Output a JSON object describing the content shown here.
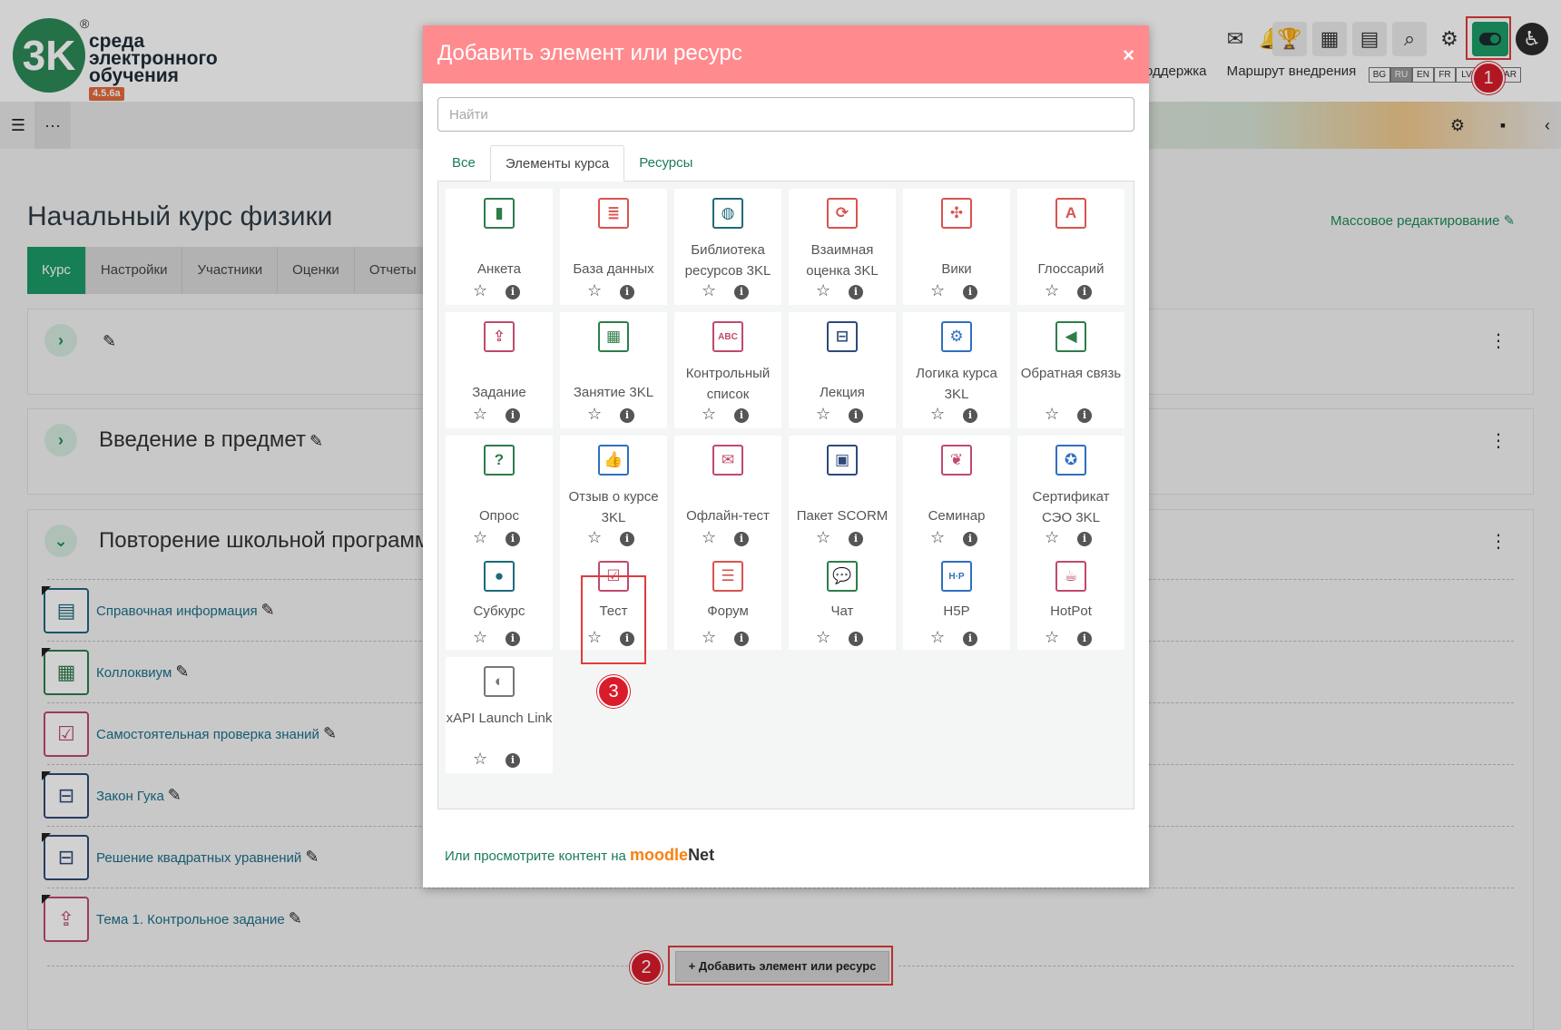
{
  "header": {
    "logo_line1": "среда",
    "logo_line2": "электронного",
    "logo_line3": "обучения",
    "logo_mark": "3K",
    "version": "4.5.6a",
    "links": [
      "оддержка",
      "Маршрут внедрения"
    ],
    "languages": [
      "BG",
      "RU",
      "EN",
      "FR",
      "LV",
      "HE",
      "AR"
    ],
    "active_language": "RU"
  },
  "course": {
    "title": "Начальный курс физики",
    "mass_edit": "Массовое редактирование",
    "tabs": [
      "Курс",
      "Настройки",
      "Участники",
      "Оценки",
      "Отчеты"
    ],
    "sections": [
      {
        "title": ""
      },
      {
        "title": "Введение в предмет"
      },
      {
        "title": "Повторение школьной программ"
      }
    ],
    "activities": [
      {
        "name": "Справочная информация",
        "icon": "file-icon"
      },
      {
        "name": "Коллоквиум",
        "icon": "lesson-icon"
      },
      {
        "name": "Самостоятельная проверка знаний",
        "icon": "quiz-icon"
      },
      {
        "name": "Закон Гука",
        "icon": "lecture-icon"
      },
      {
        "name": "Решение квадратных уравнений",
        "icon": "lecture-icon"
      },
      {
        "name": "Тема 1. Контрольное задание",
        "icon": "assign-icon"
      }
    ],
    "add_button": "+ Добавить элемент или ресурс"
  },
  "modal": {
    "title": "Добавить элемент или ресурс",
    "close": "×",
    "search_placeholder": "Найти",
    "tabs": [
      "Все",
      "Элементы курса",
      "Ресурсы"
    ],
    "active_tab": "Элементы курса",
    "items": [
      {
        "label": "Анкета",
        "icon": "survey-icon",
        "color": "#2e7d4a",
        "glyph": "▮"
      },
      {
        "label": "База данных",
        "icon": "database-icon",
        "color": "#d9534f",
        "glyph": "≣"
      },
      {
        "label": "Библиотека ресурсов 3KL",
        "icon": "library-icon",
        "color": "#1e6a7a",
        "glyph": "◍"
      },
      {
        "label": "Взаимная оценка 3KL",
        "icon": "peer-review-icon",
        "color": "#d9534f",
        "glyph": "⟳"
      },
      {
        "label": "Вики",
        "icon": "wiki-icon",
        "color": "#d9534f",
        "glyph": "✣"
      },
      {
        "label": "Глоссарий",
        "icon": "glossary-icon",
        "color": "#d9534f",
        "glyph": "A"
      },
      {
        "label": "Задание",
        "icon": "assignment-icon",
        "color": "#c04a6b",
        "glyph": "⇪"
      },
      {
        "label": "Занятие 3KL",
        "icon": "lesson-icon",
        "color": "#2e7d4a",
        "glyph": "▦"
      },
      {
        "label": "Контрольный список",
        "icon": "checklist-icon",
        "color": "#c04a6b",
        "glyph": "ABC"
      },
      {
        "label": "Лекция",
        "icon": "lecture-icon",
        "color": "#2f4a7a",
        "glyph": "⊟"
      },
      {
        "label": "Логика курса 3KL",
        "icon": "course-logic-icon",
        "color": "#2f6fc0",
        "glyph": "⚙"
      },
      {
        "label": "Обратная связь",
        "icon": "feedback-icon",
        "color": "#2e7d4a",
        "glyph": "◀"
      },
      {
        "label": "Опрос",
        "icon": "choice-icon",
        "color": "#2e7d4a",
        "glyph": "?"
      },
      {
        "label": "Отзыв о курсе 3KL",
        "icon": "course-review-icon",
        "color": "#2f6fc0",
        "glyph": "👍"
      },
      {
        "label": "Офлайн-тест",
        "icon": "offline-test-icon",
        "color": "#c04a6b",
        "glyph": "✉"
      },
      {
        "label": "Пакет SCORM",
        "icon": "scorm-icon",
        "color": "#2f4a7a",
        "glyph": "▣"
      },
      {
        "label": "Семинар",
        "icon": "workshop-icon",
        "color": "#c04a6b",
        "glyph": "❦"
      },
      {
        "label": "Сертификат СЭО 3KL",
        "icon": "certificate-icon",
        "color": "#2f6fc0",
        "glyph": "✪"
      },
      {
        "label": "Субкурс",
        "icon": "subcourse-icon",
        "color": "#1e6a7a",
        "glyph": "●"
      },
      {
        "label": "Тест",
        "icon": "quiz-icon",
        "color": "#c04a6b",
        "glyph": "☑"
      },
      {
        "label": "Форум",
        "icon": "forum-icon",
        "color": "#d9534f",
        "glyph": "☰"
      },
      {
        "label": "Чат",
        "icon": "chat-icon",
        "color": "#2e7d4a",
        "glyph": "💬"
      },
      {
        "label": "H5P",
        "icon": "h5p-icon",
        "color": "#2f6fc0",
        "glyph": "H·P"
      },
      {
        "label": "HotPot",
        "icon": "hotpot-icon",
        "color": "#c04a6b",
        "glyph": "☕"
      },
      {
        "label": "xAPI Launch Link",
        "icon": "xapi-icon",
        "color": "#777777",
        "glyph": "◐"
      }
    ],
    "moodlenet_text": "Или просмотрите контент на",
    "moodlenet_logo_a": "moodle",
    "moodlenet_logo_b": "Net"
  },
  "callouts": [
    "1",
    "2",
    "3"
  ],
  "colors": {
    "accent": "#1c9b66",
    "modal_header": "#ff8b8f",
    "highlight": "#e03b3b"
  }
}
